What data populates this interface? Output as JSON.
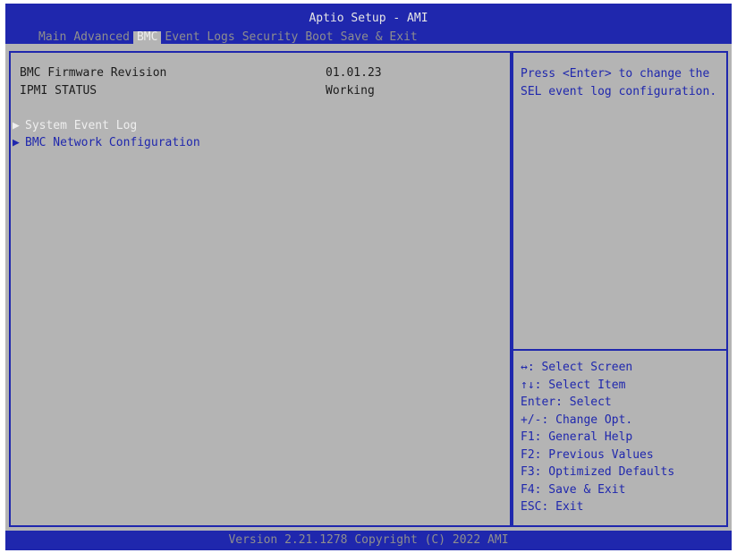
{
  "header": {
    "title": "Aptio Setup - AMI",
    "tabs": [
      {
        "label": "Main"
      },
      {
        "label": "Advanced"
      },
      {
        "label": "BMC"
      },
      {
        "label": "Event Logs"
      },
      {
        "label": "Security"
      },
      {
        "label": "Boot"
      },
      {
        "label": "Save & Exit"
      }
    ]
  },
  "main": {
    "info": [
      {
        "label": "BMC Firmware Revision",
        "value": "01.01.23"
      },
      {
        "label": "IPMI STATUS",
        "value": "Working"
      }
    ],
    "submenus": [
      {
        "arrow": "▶",
        "label": "System Event Log"
      },
      {
        "arrow": "▶",
        "label": "BMC Network Configuration"
      }
    ]
  },
  "help": {
    "text": "Press <Enter> to change the SEL event log configuration."
  },
  "keys": [
    "↔: Select Screen",
    "↑↓: Select Item",
    "Enter: Select",
    "+/-: Change Opt.",
    "F1: General Help",
    "F2: Previous Values",
    "F3: Optimized Defaults",
    "F4: Save & Exit",
    "ESC: Exit"
  ],
  "footer": {
    "version": "Version 2.21.1278 Copyright (C) 2022 AMI"
  },
  "colors": {
    "header_blue": "#1f27ad",
    "background_gray": "#b4b4b4",
    "highlight_white": "#eeeeee",
    "inactive_gray": "#8e8e8e"
  }
}
